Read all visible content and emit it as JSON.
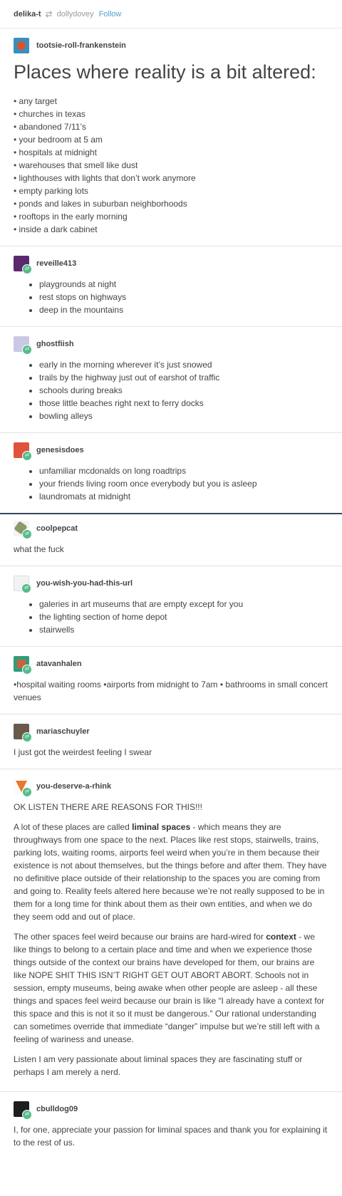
{
  "header": {
    "user": "delika-t",
    "reblogged_from": "dollydovey",
    "follow": "Follow"
  },
  "posts": [
    {
      "username": "tootsie-roll-frankenstein",
      "title": "Places where reality is a bit altered:",
      "items": [
        "• any target",
        "• churches in texas",
        "• abandoned 7/11’s",
        "• your bedroom at 5 am",
        "• hospitals at midnight",
        "• warehouses that smell like dust",
        "• lighthouses with lights that don’t work anymore",
        "• empty parking lots",
        "• ponds and lakes in suburban neighborhoods",
        "• rooftops in the early morning",
        "• inside a dark cabinet"
      ]
    },
    {
      "username": "reveille413",
      "items": [
        "playgrounds at night",
        "rest stops on highways",
        "deep in the mountains"
      ]
    },
    {
      "username": "ghostfiish",
      "items": [
        "early in the morning wherever it’s just snowed",
        "trails by the highway just out of earshot of traffic",
        "schools during breaks",
        "those little beaches right next to ferry docks",
        "bowling alleys"
      ]
    },
    {
      "username": "genesisdoes",
      "items": [
        "unfamiliar mcdonalds on long roadtrips",
        "your friends living room once everybody but you is asleep",
        "laundromats at midnight"
      ]
    },
    {
      "username": "coolpepcat",
      "text": "what the fuck"
    },
    {
      "username": "you-wish-you-had-this-url",
      "items": [
        "galeries in art museums that are empty except for you",
        "the lighting section of home depot",
        "stairwells"
      ]
    },
    {
      "username": "atavanhalen",
      "text": "•hospital waiting rooms •airports from midnight to 7am • bathrooms in small concert venues"
    },
    {
      "username": "mariaschuyler",
      "text": "I just got the weirdest feeling I swear"
    },
    {
      "username": "you-deserve-a-rhink",
      "p0": "OK LISTEN THERE ARE REASONS FOR THIS!!!",
      "p1a": "A lot of these places are called ",
      "p1b": "liminal spaces",
      "p1c": " - which means they are throughways from one space to the next. Places like rest stops, stairwells, trains, parking lots, waiting rooms, airports feel weird when you’re in them because their existence is not about themselves, but the things before and after them. They have no definitive place outside of their relationship to the spaces you are coming from and going to. Reality feels altered here because we’re not really supposed to be in them for a long time for think about them as their own entities, and when we do they seem odd and out of place.",
      "p2a": "The other spaces feel weird because our brains are hard-wired for ",
      "p2b": "context",
      "p2c": " - we like things to belong to a certain place and time and when we experience those things outside of the context our brains have developed for them, our brains are like NOPE SHIT THIS ISN’T RIGHT GET OUT ABORT ABORT. Schools not in session, empty museums, being awake when other people are asleep - all these things and spaces feel weird because our brain is like “I already have a context for this space and this is not it so it must be dangerous.” Our rational understanding can sometimes override that immediate “danger” impulse but we’re still left with a feeling of wariness and unease.",
      "p3": "Listen I am very passionate about liminal spaces they are fascinating stuff or perhaps I am merely a nerd."
    },
    {
      "username": "cbulldog09",
      "text": "I, for one, appreciate your passion for liminal spaces and thank you for explaining it to the rest of us."
    }
  ],
  "colors": {
    "link": "#529ecc",
    "reblog_badge": "#56bc8a",
    "text": "#444444"
  }
}
